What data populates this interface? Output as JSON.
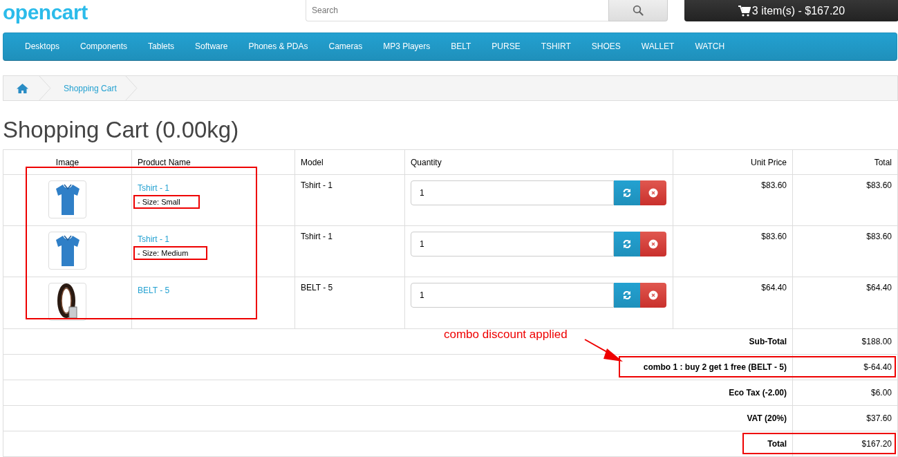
{
  "header": {
    "logo": "opencart",
    "search": {
      "placeholder": "Search"
    },
    "cart_button": "3 item(s) - $167.20"
  },
  "nav": [
    "Desktops",
    "Components",
    "Tablets",
    "Software",
    "Phones & PDAs",
    "Cameras",
    "MP3 Players",
    "BELT",
    "PURSE",
    "TSHIRT",
    "SHOES",
    "WALLET",
    "WATCH"
  ],
  "breadcrumb": [
    {
      "kind": "home"
    },
    {
      "kind": "link",
      "label": "Shopping Cart"
    }
  ],
  "page_title": "Shopping Cart (0.00kg)",
  "cart_table": {
    "columns": [
      "Image",
      "Product Name",
      "Model",
      "Quantity",
      "Unit Price",
      "Total"
    ],
    "rows": [
      {
        "kind": "tshirt",
        "name": "Tshirt - 1",
        "option": {
          "text": "- Size: Small",
          "highlighted": true
        },
        "model": "Tshirt - 1",
        "quantity": "1",
        "unit_price": "$83.60",
        "total": "$83.60"
      },
      {
        "kind": "tshirt",
        "name": "Tshirt - 1",
        "option": {
          "text": "- Size: Medium",
          "highlighted": true
        },
        "model": "Tshirt - 1",
        "quantity": "1",
        "unit_price": "$83.60",
        "total": "$83.60"
      },
      {
        "kind": "belt",
        "name": "BELT - 5",
        "model": "BELT - 5",
        "quantity": "1",
        "unit_price": "$64.40",
        "total": "$64.40"
      }
    ]
  },
  "totals": [
    {
      "label": "Sub-Total",
      "value": "$188.00",
      "highlighted": false
    },
    {
      "label": "combo 1 : buy 2 get 1 free (BELT - 5)",
      "value": "$-64.40",
      "highlighted": true
    },
    {
      "label": "Eco Tax (-2.00)",
      "value": "$6.00",
      "highlighted": false
    },
    {
      "label": "VAT (20%)",
      "value": "$37.60",
      "highlighted": false
    },
    {
      "label": "Total",
      "value": "$167.20",
      "highlighted": true
    }
  ],
  "annotation": {
    "note": "combo discount applied"
  }
}
